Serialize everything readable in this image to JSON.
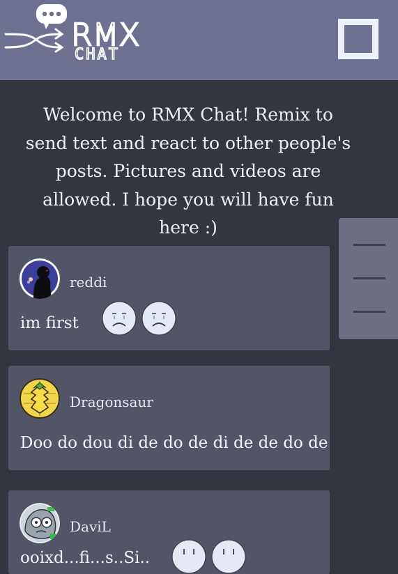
{
  "header": {
    "logo_line1": "RMX",
    "logo_line2": "CHAT"
  },
  "welcome": {
    "lines": [
      "Welcome to RMX Chat! Remix to",
      "send text and react to other people's",
      "posts. Pictures and videos are",
      "allowed. I hope you will have fun",
      "here :)"
    ]
  },
  "posts": [
    {
      "username": "reddi",
      "message": "im first",
      "reactions": [
        "sad-face",
        "sad-face"
      ]
    },
    {
      "username": "Dragonsaur",
      "message": "Doo do dou di de do de di de de do de",
      "reactions": []
    },
    {
      "username": "DaviL",
      "message": "ooixd...fi...s..Si..",
      "reactions": [
        "sad-face",
        "sad-face"
      ]
    }
  ],
  "colors": {
    "background": "#33363f",
    "header": "#6e7191",
    "post": "#525566",
    "side_panel": "#6c6e84"
  }
}
